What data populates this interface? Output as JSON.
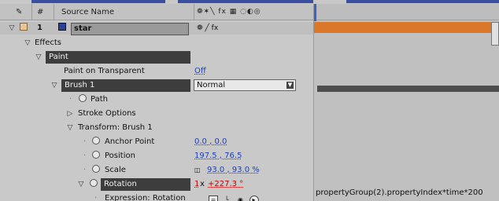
{
  "header": {
    "num": "#",
    "source_name": "Source Name",
    "switch_icons": "❁✶╲ fx ▦ ◌◐◎"
  },
  "layer": {
    "index": "1",
    "name": "star",
    "switches": "❁  ╱ fx",
    "label_color": "#e9c49a",
    "source_color": "#2a3f9e"
  },
  "tree": {
    "effects": "Effects",
    "paint": "Paint",
    "paint_on_transparent": "Paint on Transparent",
    "paint_on_transparent_value": "Off",
    "brush": "Brush 1",
    "brush_mode": "Normal",
    "path": "Path",
    "stroke_options": "Stroke Options",
    "transform": "Transform: Brush 1",
    "anchor_point": "Anchor Point",
    "anchor_point_value": "0.0 , 0.0",
    "position": "Position",
    "position_value": "197.5 , 76.5",
    "scale": "Scale",
    "scale_value": "93.0 , 93.0 %",
    "rotation": "Rotation",
    "rotation_revs": "1",
    "rotation_x": " x ",
    "rotation_deg": "+227.3 °",
    "expression": "Expression: Rotation"
  },
  "timeline": {
    "expression_text": "propertyGroup(2).propertyIndex*time*200",
    "layer_bar_color": "#d9772a"
  }
}
